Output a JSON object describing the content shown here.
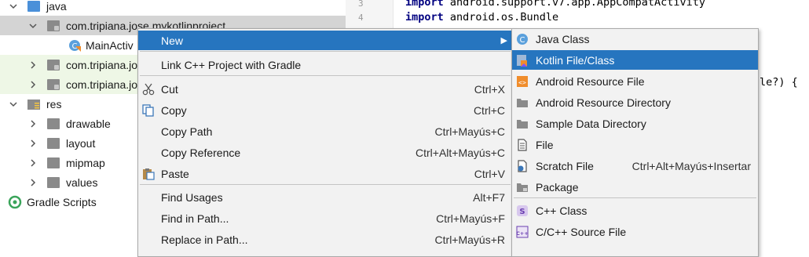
{
  "tree": {
    "items": [
      {
        "label": "java"
      },
      {
        "label": "com.tripiana.jose.mykotlinproject"
      },
      {
        "label": "MainActiv"
      },
      {
        "label": "com.tripiana.jo"
      },
      {
        "label": "com.tripiana.jo"
      },
      {
        "label": "res"
      },
      {
        "label": "drawable"
      },
      {
        "label": "layout"
      },
      {
        "label": "mipmap"
      },
      {
        "label": "values"
      },
      {
        "label": "Gradle Scripts"
      }
    ]
  },
  "editor": {
    "line_numbers": [
      "3",
      "4"
    ],
    "lines": [
      {
        "keyword": "import",
        "rest": " android.support.v7.app.AppCompatActivity"
      },
      {
        "keyword": "import",
        "rest": " android.os.Bundle"
      }
    ],
    "partial_text": "le?) {"
  },
  "context_menu": {
    "items": [
      {
        "label": "New",
        "shortcut": "",
        "has_submenu": true,
        "highlighted": true
      },
      {
        "label": "Link C++ Project with Gradle",
        "shortcut": ""
      },
      {
        "label": "Cut",
        "shortcut": "Ctrl+X",
        "icon": "scissors-icon"
      },
      {
        "label": "Copy",
        "shortcut": "Ctrl+C",
        "icon": "copy-icon"
      },
      {
        "label": "Copy Path",
        "shortcut": "Ctrl+Mayús+C"
      },
      {
        "label": "Copy Reference",
        "shortcut": "Ctrl+Alt+Mayús+C"
      },
      {
        "label": "Paste",
        "shortcut": "Ctrl+V",
        "icon": "paste-icon"
      },
      {
        "label": "Find Usages",
        "shortcut": "Alt+F7"
      },
      {
        "label": "Find in Path...",
        "shortcut": "Ctrl+Mayús+F"
      },
      {
        "label": "Replace in Path...",
        "shortcut": "Ctrl+Mayús+R"
      }
    ]
  },
  "submenu": {
    "items": [
      {
        "label": "Java Class",
        "shortcut": "",
        "icon": "java-class-icon"
      },
      {
        "label": "Kotlin File/Class",
        "shortcut": "",
        "icon": "kotlin-icon",
        "highlighted": true
      },
      {
        "label": "Android Resource File",
        "shortcut": "",
        "icon": "android-resource-file-icon"
      },
      {
        "label": "Android Resource Directory",
        "shortcut": "",
        "icon": "folder-icon"
      },
      {
        "label": "Sample Data Directory",
        "shortcut": "",
        "icon": "folder-icon"
      },
      {
        "label": "File",
        "shortcut": "",
        "icon": "file-icon"
      },
      {
        "label": "Scratch File",
        "shortcut": "Ctrl+Alt+Mayús+Insertar",
        "icon": "scratch-file-icon"
      },
      {
        "label": "Package",
        "shortcut": "",
        "icon": "package-icon"
      },
      {
        "label": "C++ Class",
        "shortcut": "",
        "icon": "cpp-class-icon"
      },
      {
        "label": "C/C++ Source File",
        "shortcut": "",
        "icon": "cpp-source-icon"
      }
    ]
  },
  "colors": {
    "highlight": "#2675bf",
    "selected_row": "#d4d4d4",
    "keyword": "#000080",
    "menu_bg": "#f2f2f2"
  }
}
